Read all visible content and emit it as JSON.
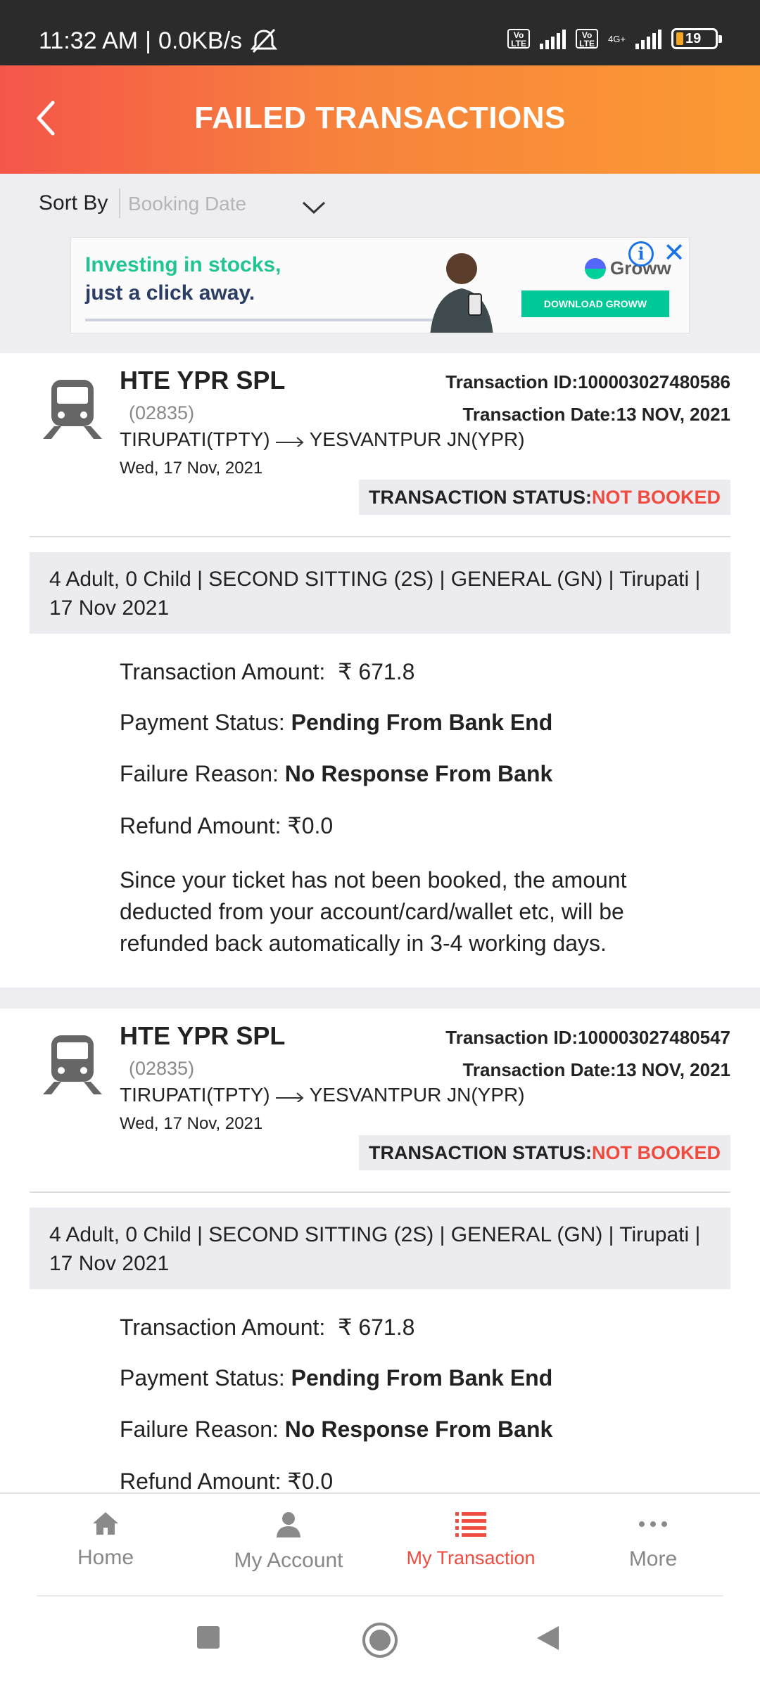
{
  "status_bar": {
    "time": "11:32 AM",
    "speed": "0.0KB/s",
    "battery": "19",
    "volte": "Vo LTE",
    "network": "4G+"
  },
  "header": {
    "title": "FAILED TRANSACTIONS"
  },
  "sort": {
    "label": "Sort By",
    "placeholder": "Booking Date"
  },
  "ad": {
    "line1": "Investing in stocks,",
    "line2": "just a click away.",
    "brand": "Groww",
    "cta": "DOWNLOAD GROWW"
  },
  "transactions": [
    {
      "train_name": "HTE YPR SPL",
      "train_no": "(02835)",
      "from": "TIRUPATI(TPTY)",
      "to": "YESVANTPUR JN(YPR)",
      "journey_date": "Wed, 17 Nov, 2021",
      "txn_id": "Transaction ID:100003027480586",
      "txn_date": "Transaction Date:13 NOV, 2021",
      "status_label": "TRANSACTION STATUS:",
      "status_value": "NOT BOOKED",
      "summary": "4 Adult, 0 Child | SECOND SITTING (2S) | GENERAL (GN) | Tirupati | 17 Nov 2021",
      "amount_label": "Transaction Amount:",
      "amount_value": "₹ 671.8",
      "payment_label": "Payment Status:",
      "payment_value": "Pending From Bank End",
      "failure_label": "Failure Reason:",
      "failure_value": "No Response From Bank",
      "refund": "Refund Amount: ₹0.0",
      "note": "Since your ticket has not been booked, the amount deducted from your account/card/wallet etc, will be refunded back automatically in 3-4 working days."
    },
    {
      "train_name": "HTE YPR SPL",
      "train_no": "(02835)",
      "from": "TIRUPATI(TPTY)",
      "to": "YESVANTPUR JN(YPR)",
      "journey_date": "Wed, 17 Nov, 2021",
      "txn_id": "Transaction ID:100003027480547",
      "txn_date": "Transaction Date:13 NOV, 2021",
      "status_label": "TRANSACTION STATUS:",
      "status_value": "NOT BOOKED",
      "summary": "4 Adult, 0 Child | SECOND SITTING (2S) | GENERAL (GN) | Tirupati | 17 Nov 2021",
      "amount_label": "Transaction Amount:",
      "amount_value": "₹ 671.8",
      "payment_label": "Payment Status:",
      "payment_value": "Pending From Bank End",
      "failure_label": "Failure Reason:",
      "failure_value": "No Response From Bank",
      "refund": "Refund Amount: ₹0.0"
    }
  ],
  "bottom_nav": [
    {
      "label": "Home",
      "icon": "home-icon",
      "active": false
    },
    {
      "label": "My Account",
      "icon": "account-icon",
      "active": false
    },
    {
      "label": "My Transaction",
      "icon": "list-icon",
      "active": true
    },
    {
      "label": "More",
      "icon": "more-icon",
      "active": false
    }
  ],
  "colors": {
    "header_start": "#f5564a",
    "header_end": "#fb9a33",
    "accent": "#ef4b3f"
  }
}
